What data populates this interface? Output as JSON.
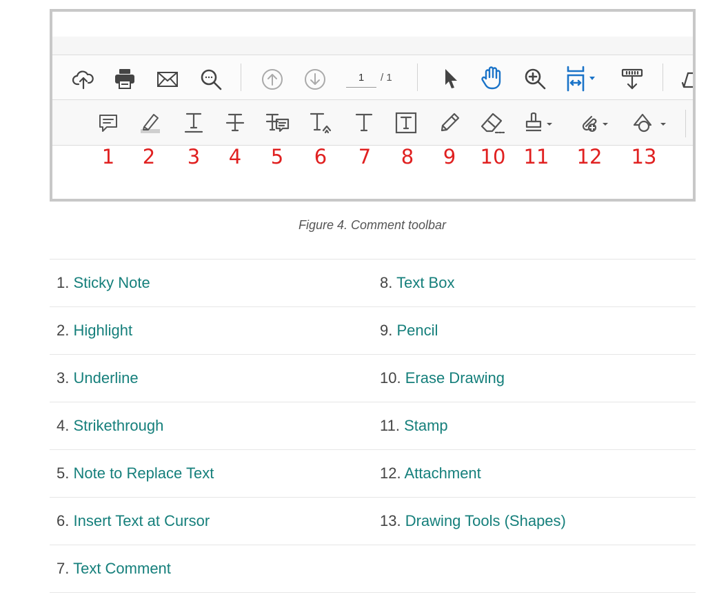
{
  "figure": {
    "page_current": "1",
    "page_total": "/ 1",
    "top_toolbar": {
      "icons": [
        "cloud-upload-icon",
        "print-icon",
        "email-icon",
        "find-icon",
        "page-up-icon",
        "page-down-icon",
        "select-cursor-icon",
        "hand-icon",
        "zoom-in-icon",
        "fit-page-icon",
        "scroll-mode-icon",
        "sign-icon"
      ]
    },
    "comment_toolbar": {
      "numbers": [
        "1",
        "2",
        "3",
        "4",
        "5",
        "6",
        "7",
        "8",
        "9",
        "10",
        "11",
        "12",
        "13"
      ],
      "icons": [
        "sticky-note-icon",
        "highlight-icon",
        "underline-icon",
        "strikethrough-icon",
        "replace-text-icon",
        "insert-text-icon",
        "text-comment-icon",
        "text-box-icon",
        "pencil-icon",
        "eraser-icon",
        "stamp-icon",
        "attachment-icon",
        "drawing-tools-icon"
      ]
    },
    "colors": {
      "number_red": "#e02020",
      "accent_blue": "#1a73c8",
      "link_teal": "#157f7b"
    }
  },
  "caption": "Figure 4. Comment toolbar",
  "list": {
    "left": [
      {
        "num": "1.",
        "label": "Sticky Note"
      },
      {
        "num": "2.",
        "label": "Highlight"
      },
      {
        "num": "3.",
        "label": "Underline"
      },
      {
        "num": "4.",
        "label": "Strikethrough"
      },
      {
        "num": "5.",
        "label": "Note to Replace Text"
      },
      {
        "num": "6.",
        "label": "Insert Text at Cursor"
      },
      {
        "num": "7.",
        "label": "Text Comment"
      }
    ],
    "right": [
      {
        "num": "8.",
        "label": "Text Box"
      },
      {
        "num": "9.",
        "label": "Pencil"
      },
      {
        "num": "10.",
        "label": "Erase Drawing"
      },
      {
        "num": "11.",
        "label": "Stamp"
      },
      {
        "num": "12.",
        "label": "Attachment"
      },
      {
        "num": "13.",
        "label": "Drawing Tools (Shapes)"
      }
    ]
  }
}
